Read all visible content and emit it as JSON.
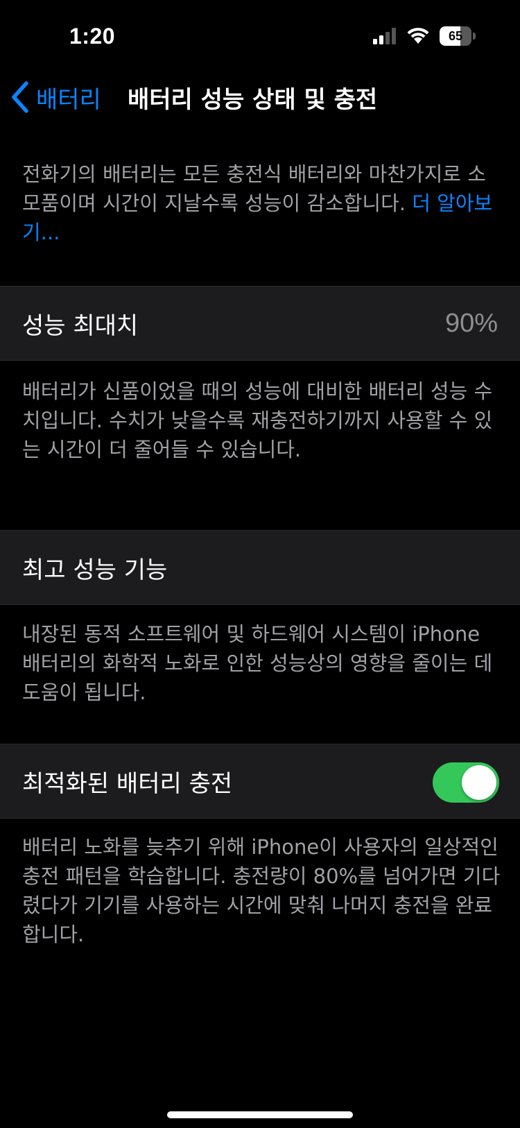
{
  "status_bar": {
    "time": "1:20",
    "battery_level": "65",
    "battery_fraction": 0.65,
    "icons": [
      "cellular-signal-icon",
      "wifi-icon",
      "battery-icon"
    ]
  },
  "nav": {
    "back_label": "배터리",
    "title": "배터리 성능 상태 및 충전"
  },
  "intro": {
    "text": "전화기의 배터리는 모든 충전식 배터리와 마찬가지로 소모품이며 시간이 지날수록 성능이 감소합니다. ",
    "link": "더 알아보기..."
  },
  "max_capacity": {
    "label": "성능 최대치",
    "value": "90%",
    "description": "배터리가 신품이었을 때의 성능에 대비한 배터리 성능 수치입니다. 수치가 낮을수록 재충전하기까지 사용할 수 있는 시간이 더 줄어들 수 있습니다."
  },
  "peak_performance": {
    "label": "최고 성능 기능",
    "description": "내장된 동적 소프트웨어 및 하드웨어 시스템이 iPhone 배터리의 화학적 노화로 인한 성능상의 영향을 줄이는 데 도움이 됩니다."
  },
  "optimized_charging": {
    "label": "최적화된 배터리 충전",
    "enabled": true,
    "description": "배터리 노화를 늦추기 위해 iPhone이 사용자의 일상적인 충전 패턴을 학습합니다. 충전량이 80%를 넘어가면 기다렸다가 기기를 사용하는 시간에 맞춰 나머지 충전을 완료합니다."
  },
  "colors": {
    "background": "#000000",
    "cell": "#1C1C1E",
    "accent": "#0A84FF",
    "toggle_on": "#34C759",
    "secondary_text": "#A1A1A6"
  }
}
